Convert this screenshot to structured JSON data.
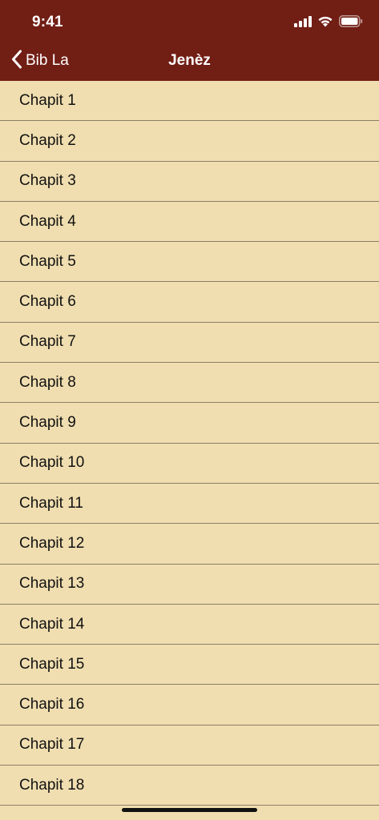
{
  "status_bar": {
    "time": "9:41",
    "icons": [
      "cellular-signal-icon",
      "wifi-icon",
      "battery-icon"
    ]
  },
  "nav": {
    "back_label": "Bib La",
    "title": "Jenèz"
  },
  "colors": {
    "header_bg": "#711e15",
    "list_bg": "#f0deb0",
    "separator": "#8a7e66",
    "text": "#111111"
  },
  "chapters": [
    "Chapit 1",
    "Chapit 2",
    "Chapit 3",
    "Chapit 4",
    "Chapit 5",
    "Chapit 6",
    "Chapit 7",
    "Chapit 8",
    "Chapit 9",
    "Chapit 10",
    "Chapit 11",
    "Chapit 12",
    "Chapit 13",
    "Chapit 14",
    "Chapit 15",
    "Chapit 16",
    "Chapit 17",
    "Chapit 18"
  ]
}
